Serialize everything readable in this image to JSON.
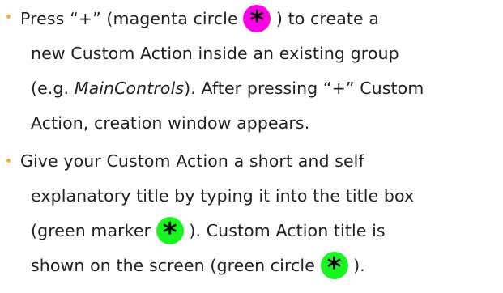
{
  "colors": {
    "bullet": "#f0b429",
    "text": "#1f1f1f",
    "magenta_marker": "#ff00e6",
    "green_marker": "#19f51e"
  },
  "icons": {
    "marker_symbol": "*",
    "magenta_marker_icon": "asterisk-icon",
    "green_marker_icon": "asterisk-icon"
  },
  "bullets": [
    {
      "line1_a": "Press “+” (magenta circle ",
      "line1_b": " ) to create a",
      "line2": "new Custom Action inside an existing group",
      "line3_a": "(e.g. ",
      "line3_em": "MainControls",
      "line3_b": "). After pressing “+” Custom",
      "line4": "Action, creation window appears."
    },
    {
      "line1": "Give your Custom Action a short and self",
      "line2": "explanatory title by typing it into the title box",
      "line3_a": "(green marker ",
      "line3_b": " ). Custom Action title is",
      "line4_a": "shown on the screen (green circle ",
      "line4_b": " )."
    }
  ]
}
